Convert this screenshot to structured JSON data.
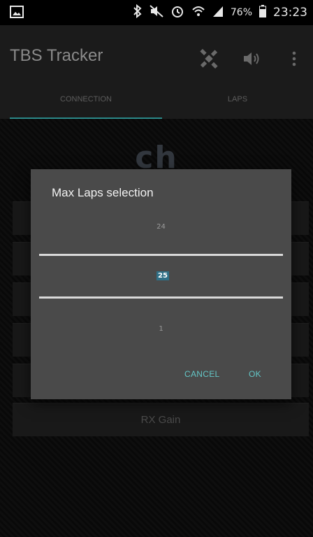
{
  "status_bar": {
    "battery_text": "76%",
    "time": "23:23",
    "icons": [
      "image-notification-icon",
      "bluetooth-icon",
      "mute-icon",
      "alarm-icon",
      "wifi-icon",
      "signal-icon",
      "battery-icon"
    ]
  },
  "app_bar": {
    "title": "TBS Tracker",
    "actions": [
      "antenna-icon",
      "volume-icon",
      "overflow-menu-icon"
    ]
  },
  "tabs": [
    {
      "label": "CONNECTION",
      "active": true
    },
    {
      "label": "LAPS",
      "active": false
    }
  ],
  "background": {
    "channel_header": "ch",
    "rx_gain_label": "RX Gain"
  },
  "dialog": {
    "title": "Max Laps selection",
    "picker": {
      "above": "24",
      "selected": "25",
      "below": "1"
    },
    "cancel_label": "CANCEL",
    "ok_label": "OK"
  },
  "colors": {
    "accent": "#63c6c6",
    "tab_indicator": "#2b8a8a",
    "dialog_bg": "#4a4a4a",
    "selected_bg": "#2f6f86"
  }
}
